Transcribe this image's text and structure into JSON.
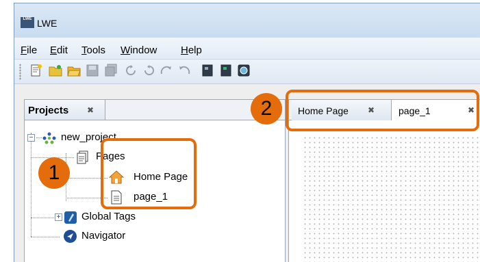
{
  "window": {
    "title": "LWE",
    "icon": "lwe-app-icon",
    "icon_text": "LWE"
  },
  "menubar": {
    "items": [
      {
        "label": "File",
        "mnemonic": "F",
        "rest": "ile"
      },
      {
        "label": "Edit",
        "mnemonic": "E",
        "rest": "dit"
      },
      {
        "label": "Tools",
        "mnemonic": "T",
        "rest": "ools"
      },
      {
        "label": "Window",
        "mnemonic": "W",
        "rest": "indow"
      },
      {
        "label": "Help",
        "mnemonic": "H",
        "rest": "elp"
      }
    ]
  },
  "toolbar": {
    "buttons": [
      "new-page-icon",
      "new-project-icon",
      "open-folder-icon",
      "save-icon",
      "save-all-icon",
      "undo-icon",
      "redo-icon",
      "redo-forward-icon",
      "undo-back-icon",
      "run-dark-icon",
      "run-green-icon",
      "preview-icon"
    ]
  },
  "projects_panel": {
    "title": "Projects",
    "tree": {
      "root": "new_project",
      "pages_label": "Pages",
      "home_page": "Home Page",
      "page_1": "page_1",
      "global_tags": "Global Tags",
      "navigator": "Navigator"
    }
  },
  "editor": {
    "tabs": [
      {
        "label": "Home Page"
      },
      {
        "label": "page_1"
      }
    ]
  },
  "callouts": {
    "one": "1",
    "two": "2"
  },
  "colors": {
    "callout": "#e46c0a",
    "panel_border": "#9aa7b8",
    "title_bar": "#c9dcf0"
  }
}
